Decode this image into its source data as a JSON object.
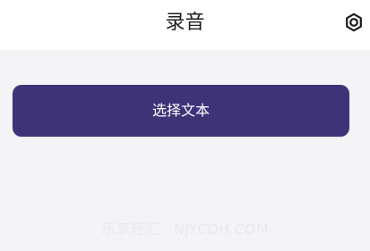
{
  "header": {
    "title": "录音",
    "settings_icon": "settings-icon"
  },
  "main": {
    "primary_button_label": "选择文本"
  },
  "watermark": {
    "text": "乐享轻汇 · NJYCOH.COM"
  },
  "colors": {
    "header_bg": "#ffffff",
    "page_bg": "#f4f4f6",
    "button_bg": "#3f3378",
    "button_text": "#ffffff",
    "title_text": "#1f1f1f"
  }
}
